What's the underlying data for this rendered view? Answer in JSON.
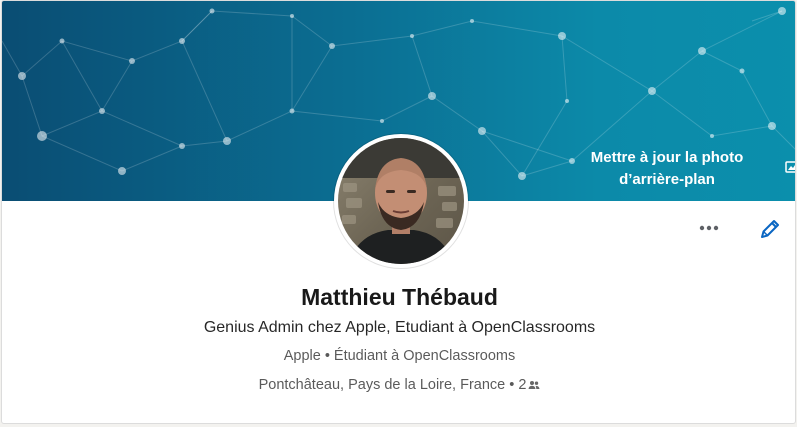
{
  "banner": {
    "cta_line1": "Mettre à jour la photo",
    "cta_line2": "d’arrière-plan",
    "colors": {
      "start": "#0a4d73",
      "end": "#0b8fac"
    }
  },
  "profile": {
    "name": "Matthieu Thébaud",
    "headline": "Genius Admin chez Apple, Etudiant à OpenClassrooms",
    "company": "Apple",
    "school": "Étudiant à OpenClassrooms",
    "location": "Pontchâteau, Pays de la Loire, France",
    "separator": "•",
    "connections": "2"
  },
  "actions": {
    "more_icon": "more-horizontal-icon",
    "edit_icon": "pencil-icon",
    "accent": "#0a66c2"
  }
}
